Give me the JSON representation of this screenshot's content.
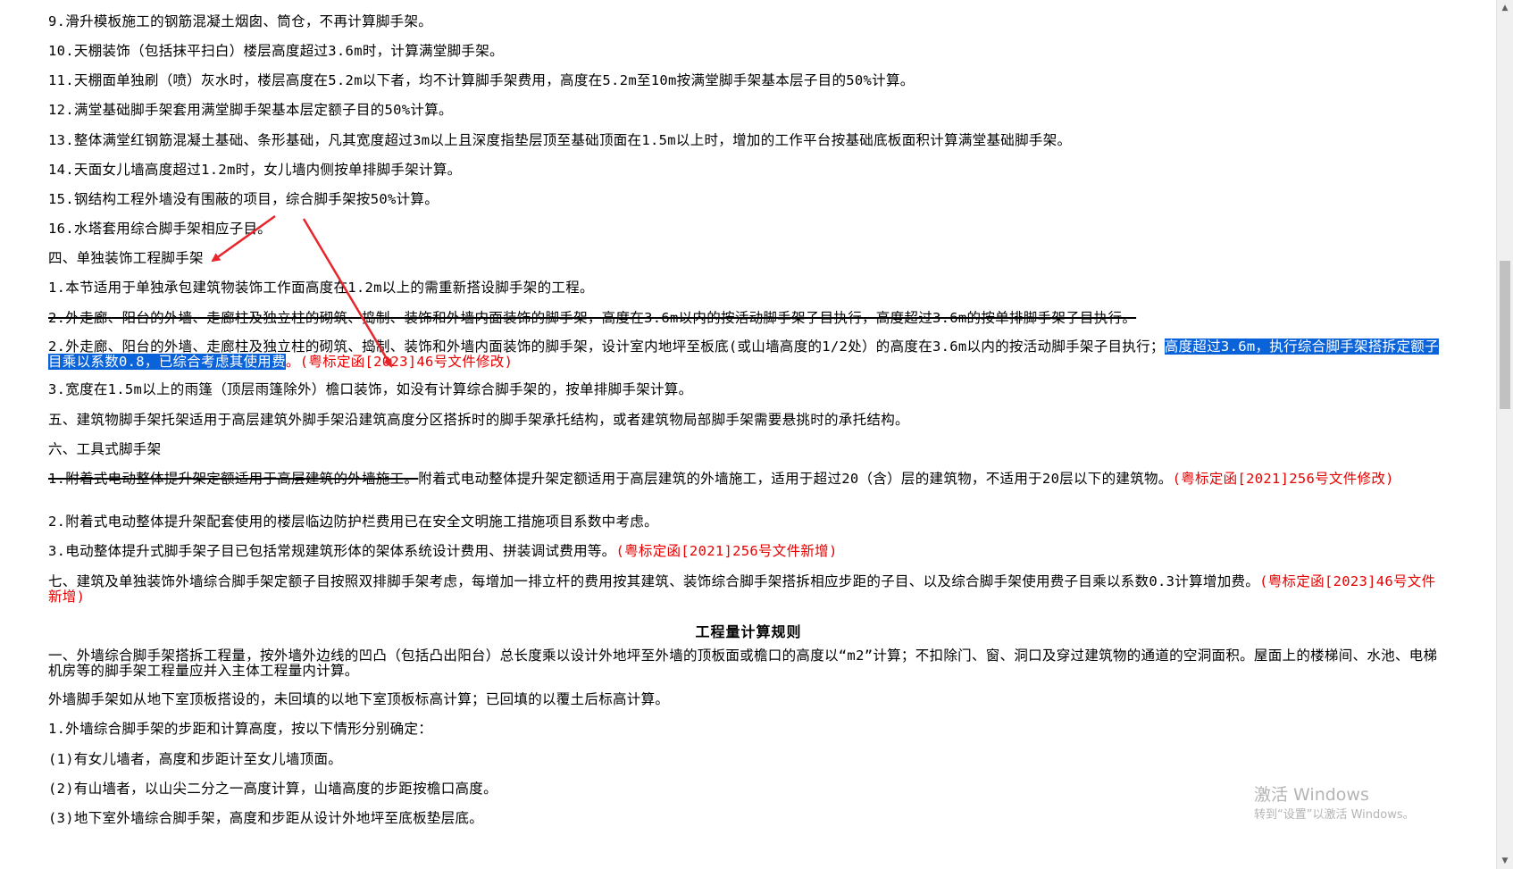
{
  "lines": {
    "l9": "9.滑升模板施工的钢筋混凝土烟囱、筒仓，不再计算脚手架。",
    "l10": "10.天棚装饰（包括抹平扫白）楼层高度超过3.6m时，计算满堂脚手架。",
    "l11": "11.天棚面单独刷（喷）灰水时，楼层高度在5.2m以下者，均不计算脚手架费用，高度在5.2m至10m按满堂脚手架基本层子目的50%计算。",
    "l12": "12.满堂基础脚手架套用满堂脚手架基本层定额子目的50%计算。",
    "l13": "13.整体满堂红钢筋混凝土基础、条形基础，凡其宽度超过3m以上且深度指垫层顶至基础顶面在1.5m以上时，增加的工作平台按基础底板面积计算满堂基础脚手架。",
    "l14": "14.天面女儿墙高度超过1.2m时，女儿墙内侧按单排脚手架计算。",
    "l15": "15.钢结构工程外墙没有围蔽的项目，综合脚手架按50%计算。",
    "l16": "16.水塔套用综合脚手架相应子目。",
    "s4_heading": "四、单独装饰工程脚手架",
    "s4_1": "1.本节适用于单独承包建筑物装饰工作面高度在1.2m以上的需重新搭设脚手架的工程。",
    "s4_2_old": "2.外走廊、阳台的外墙、走廊柱及独立柱的砌筑、捣制、装饰和外墙内面装饰的脚手架，高度在3.6m以内的按活动脚手架子目执行，高度超过3.6m的按单排脚手架子目执行。",
    "s4_2_new_a": "2.外走廊、阳台的外墙、走廊柱及独立柱的砌筑、捣制、装饰和外墙内面装饰的脚手架，设计室内地坪至板底(或山墙高度的1/2处）的高度在3.6m以内的按活动脚手架子目执行；",
    "s4_2_new_hl": "高度超过3.6m，执行综合脚手架搭拆定额子目乘以系数0.8，已综合考虑其使用费",
    "s4_2_new_note": "。(粤标定函[2023]46号文件修改)",
    "s4_3": "3.宽度在1.5m以上的雨篷（顶层雨篷除外）檐口装饰，如没有计算综合脚手架的，按单排脚手架计算。",
    "s5": "五、建筑物脚手架托架适用于高层建筑外脚手架沿建筑高度分区搭拆时的脚手架承托结构，或者建筑物局部脚手架需要悬挑时的承托结构。",
    "s6_heading": "六、工具式脚手架",
    "s6_1_old": "1.附着式电动整体提升架定额适用于高层建筑的外墙施工。",
    "s6_1_new": "附着式电动整体提升架定额适用于高层建筑的外墙施工，适用于超过20（含）层的建筑物，不适用于20层以下的建筑物。",
    "s6_1_note": "(粤标定函[2021]256号文件修改)",
    "s6_2": "2.附着式电动整体提升架配套使用的楼层临边防护栏费用已在安全文明施工措施项目系数中考虑。",
    "s6_3": "3.电动整体提升式脚手架子目已包括常规建筑形体的架体系统设计费用、拼装调试费用等。",
    "s6_3_note": "(粤标定函[2021]256号文件新增)",
    "s7": "七、建筑及单独装饰外墙综合脚手架定额子目按照双排脚手架考虑，每增加一排立杆的费用按其建筑、装饰综合脚手架搭拆相应步距的子目、以及综合脚手架使用费子目乘以系数0.3计算增加费。",
    "s7_note": "(粤标定函[2023]46号文件新增)",
    "rules_title": "工程量计算规则",
    "r1": "一、外墙综合脚手架搭拆工程量，按外墙外边线的凹凸（包括凸出阳台）总长度乘以设计外地坪至外墙的顶板面或檐口的高度以“m2”计算；不扣除门、窗、洞口及穿过建筑物的通道的空洞面积。屋面上的楼梯间、水池、电梯机房等的脚手架工程量应并入主体工程量内计算。",
    "r2": "外墙脚手架如从地下室顶板搭设的，未回填的以地下室顶板标高计算；已回填的以覆土后标高计算。",
    "r3": "1.外墙综合脚手架的步距和计算高度，按以下情形分别确定：",
    "r4": "(1)有女儿墙者，高度和步距计至女儿墙顶面。",
    "r5": "(2)有山墙者，以山尖二分之一高度计算，山墙高度的步距按檐口高度。",
    "r6": "(3)地下室外墙综合脚手架，高度和步距从设计外地坪至底板垫层底。"
  },
  "watermark": {
    "line1": "激活 Windows",
    "line2": "转到“设置”以激活 Windows。"
  },
  "scrollbar": {
    "up_icon": "▲",
    "down_icon": "▼"
  },
  "colors": {
    "highlight": "#0a63d8",
    "note_red": "#e60000",
    "arrow_red": "#e8252b"
  }
}
